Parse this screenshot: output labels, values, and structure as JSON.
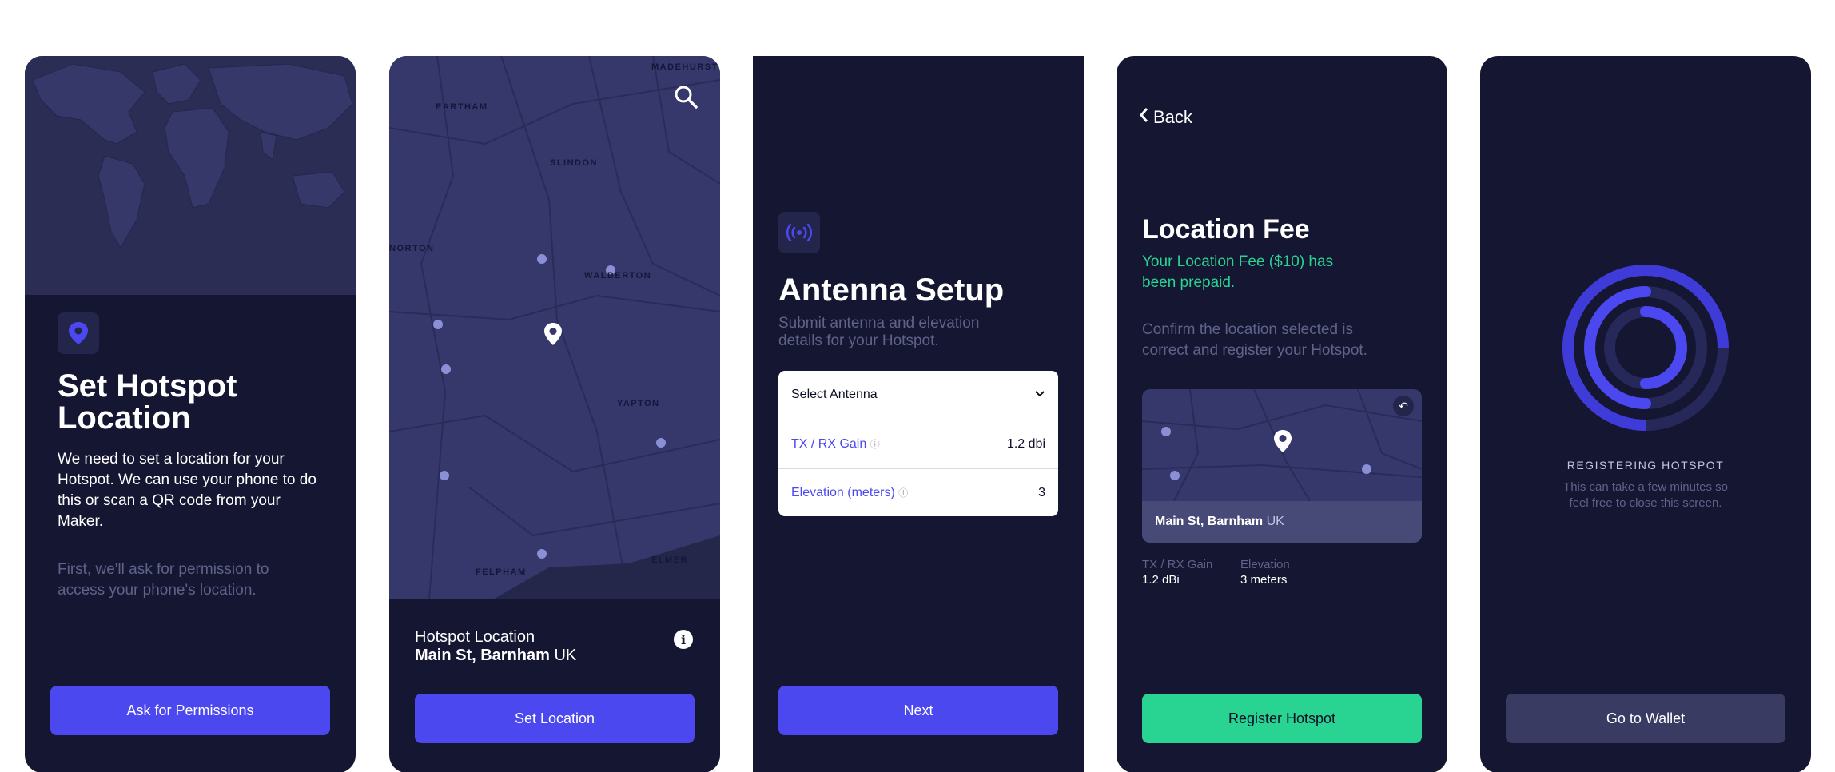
{
  "screen1": {
    "title": "Set Hotspot Location",
    "body": "We need to set a location for your Hotspot. We can use your phone to do this or scan a QR code from your Maker.",
    "note": "First, we'll ask for permission to access your phone's location.",
    "button": "Ask for Permissions",
    "icon": "location-pin-icon"
  },
  "screen2": {
    "map_labels": [
      "MADEHURST",
      "EARTHAM",
      "SLINDON",
      "NORTON",
      "WALBERTON",
      "YAPTON",
      "FELPHAM",
      "ELMER"
    ],
    "location_label": "Hotspot Location",
    "location_street": "Main St, Barnham",
    "location_country": "UK",
    "button": "Set Location"
  },
  "screen3": {
    "title": "Antenna Setup",
    "subtitle": "Submit antenna and elevation details for your Hotspot.",
    "select_label": "Select Antenna",
    "gain_label": "TX / RX Gain",
    "gain_value": "1.2 dbi",
    "elevation_label": "Elevation (meters)",
    "elevation_value": "3",
    "button": "Next"
  },
  "screen4": {
    "back": "Back",
    "title": "Location Fee",
    "prepaid": "Your Location Fee ($10) has been prepaid.",
    "confirm": "Confirm the location selected is correct and register your Hotspot.",
    "map_street": "Main St, Barnham",
    "map_country": "UK",
    "gain_label": "TX / RX Gain",
    "gain_value": "1.2 dBi",
    "elevation_label": "Elevation",
    "elevation_value": "3 meters",
    "button": "Register Hotspot"
  },
  "screen5": {
    "status": "REGISTERING HOTSPOT",
    "note": "This can take a few minutes so feel free to close this screen.",
    "button": "Go to Wallet"
  },
  "colors": {
    "bg": "#141632",
    "accent": "#4b48ef",
    "green": "#29d391",
    "muted": "#5f6389"
  }
}
